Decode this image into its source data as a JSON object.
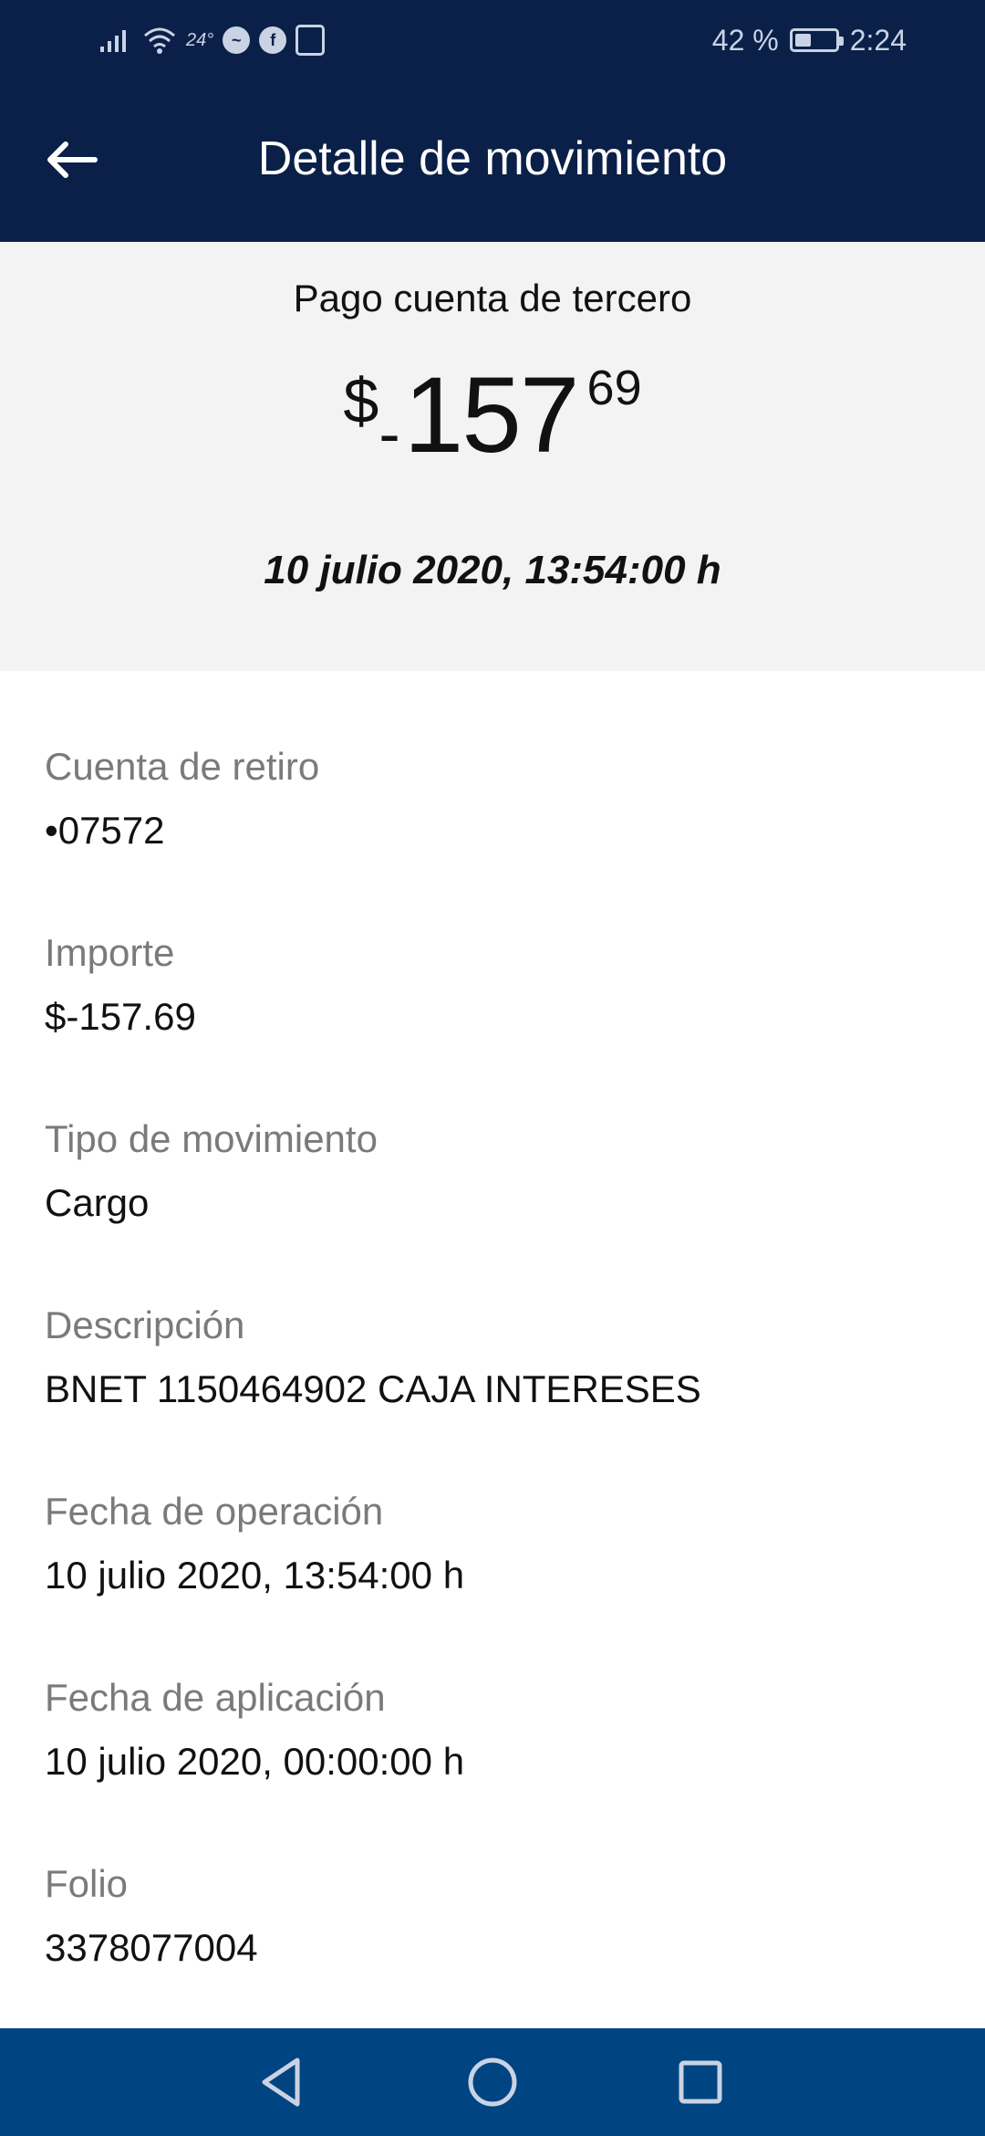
{
  "status_bar": {
    "temperature": "24°",
    "battery": "42 %",
    "battery_level": 0.42,
    "time": "2:24"
  },
  "app_bar": {
    "title": "Detalle de movimiento"
  },
  "summary": {
    "concept": "Pago cuenta de tercero",
    "amount_currency": "$",
    "amount_sign": "-",
    "amount_integer": "157",
    "amount_decimal": "69",
    "datetime": "10 julio 2020, 13:54:00 h"
  },
  "details": [
    {
      "label": "Cuenta de retiro",
      "value": "•07572"
    },
    {
      "label": "Importe",
      "value": "$-157.69"
    },
    {
      "label": "Tipo de movimiento",
      "value": "Cargo"
    },
    {
      "label": "Descripción",
      "value": "BNET 1150464902 CAJA INTERESES"
    },
    {
      "label": "Fecha de operación",
      "value": "10 julio 2020, 13:54:00 h"
    },
    {
      "label": "Fecha de aplicación",
      "value": "10 julio 2020, 00:00:00 h"
    },
    {
      "label": "Folio",
      "value": "3378077004"
    }
  ],
  "colors": {
    "header": "#0a2048",
    "nav_bar": "#004481",
    "summary_bg": "#f3f3f3",
    "label": "#7a7a7a",
    "text": "#111111"
  },
  "icons": {
    "back": "arrow-left-icon",
    "nav_back": "triangle-back-icon",
    "nav_home": "circle-home-icon",
    "nav_recents": "square-recents-icon"
  }
}
